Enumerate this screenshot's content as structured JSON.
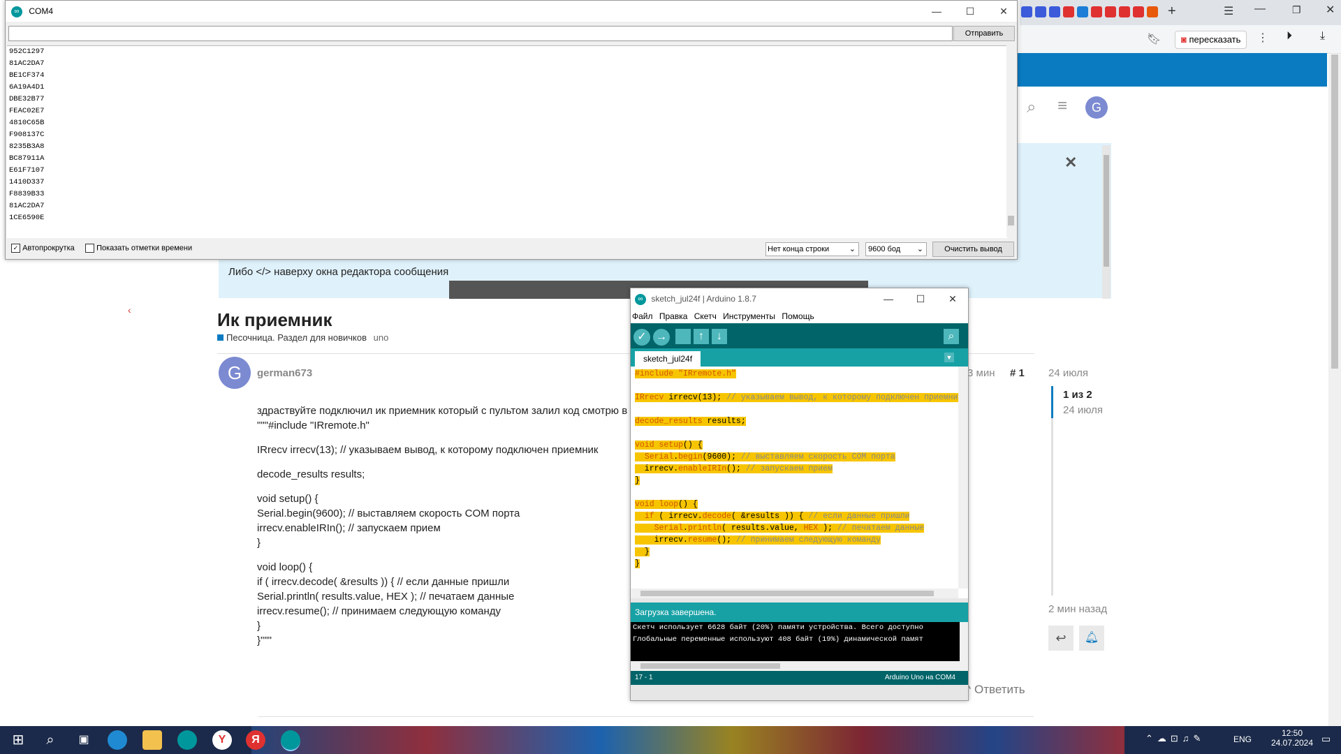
{
  "browser": {
    "tab_share_label": "пересказать"
  },
  "forum": {
    "quote_hint": "Либо </> наверху окна редактора сообщения",
    "topic_title": "Ик приемник",
    "category": "Песочница. Раздел для новичков",
    "tag": "uno",
    "author": "german673",
    "avatar_letter": "G",
    "post_time": "3 мин",
    "post_number": "# 1",
    "post_lines": [
      "здраствуйте подключил ик приемник который с пультом залил код смотрю в мониторе порта у меня на кнопки",
      "\"\"\"#include \"IRremote.h\"",
      "IRrecv irrecv(13); // указываем вывод, к которому подключен приемник",
      "decode_results results;",
      "void setup() {",
      "Serial.begin(9600); // выставляем скорость COM порта",
      "irrecv.enableIRIn(); // запускаем прием",
      "}",
      "void loop() {",
      "if ( irrecv.decode( &results )) { // если данные пришли",
      "Serial.println( results.value, HEX ); // печатаем данные",
      "irrecv.resume(); // принимаем следующую команду",
      "}",
      "}\"\"\""
    ],
    "reply_label": "Ответить",
    "timeline_date_top": "24 июля",
    "timeline_position": "1 из 2",
    "timeline_date": "24 июля",
    "timeline_ago": "2 мин назад"
  },
  "serial_monitor": {
    "title": "COM4",
    "send_button": "Отправить",
    "input_value": "",
    "output_lines": [
      "952C1297",
      "81AC2DA7",
      "BE1CF374",
      "6A19A4D1",
      "DBE32B77",
      "FEAC02E7",
      "4810C65B",
      "F908137C",
      "8235B3A8",
      "BC87911A",
      "E61F7107",
      "1410D337",
      "F8839B33",
      "81AC2DA7",
      "1CE6590E"
    ],
    "autoscroll_label": "Автопрокрутка",
    "timestamps_label": "Показать отметки времени",
    "line_ending": "Нет конца строки",
    "baud": "9600 бод",
    "clear_button": "Очистить вывод"
  },
  "ide": {
    "title": "sketch_jul24f | Arduino 1.8.7",
    "menu": [
      "Файл",
      "Правка",
      "Скетч",
      "Инструменты",
      "Помощь"
    ],
    "tab": "sketch_jul24f",
    "status": "Загрузка завершена.",
    "console_lines": [
      "Скетч использует 6628 байт (20%) памяти устройства. Всего доступно",
      "Глобальные переменные используют 408 байт (19%) динамической памят"
    ],
    "line_col": "17 - 1",
    "board": "Arduino Uno на COM4"
  },
  "taskbar": {
    "lang": "ENG",
    "time": "12:50",
    "date": "24.07.2024"
  },
  "colors": {
    "arduino_teal": "#00979c",
    "highlight": "#f7c500",
    "forum_blue": "#0a7bc1"
  }
}
